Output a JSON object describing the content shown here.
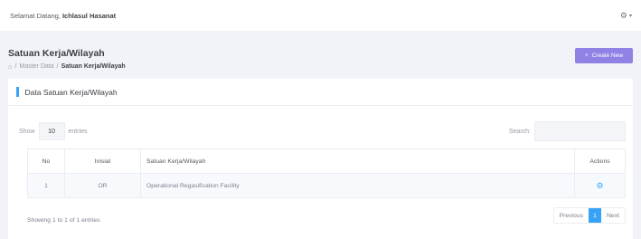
{
  "topbar": {
    "welcome_prefix": "Selamat Datang,",
    "user_name": "Ichlasul Hasanat"
  },
  "header": {
    "title": "Satuan Kerja/Wilayah",
    "breadcrumb": [
      "Master Data",
      "Satuan Kerja/Wilayah"
    ],
    "breadcrumb_sep": "/",
    "create_label": "Create New"
  },
  "card": {
    "title": "Data Satuan Kerja/Wilayah",
    "show_label": "Show",
    "entries_label": "entries",
    "length_value": "10",
    "search_label": "Search:"
  },
  "table": {
    "columns": [
      "No",
      "Inisial",
      "Satuan Kerja/Wilayah",
      "Actions"
    ],
    "rows": [
      {
        "no": "1",
        "inisial": "OR",
        "satuan": "Operational Regasification Facility"
      }
    ]
  },
  "footer": {
    "info": "Showing 1 to 1 of 1 entries",
    "prev": "Previous",
    "page": "1",
    "next": "Next"
  },
  "colors": {
    "accent": "#36a3f7",
    "create_button": "#8e83e4",
    "background": "#f2f3f8"
  },
  "icons": {
    "user_menu": "gear-icon",
    "breadcrumb_home": "home-icon",
    "row_action": "gear-icon"
  }
}
